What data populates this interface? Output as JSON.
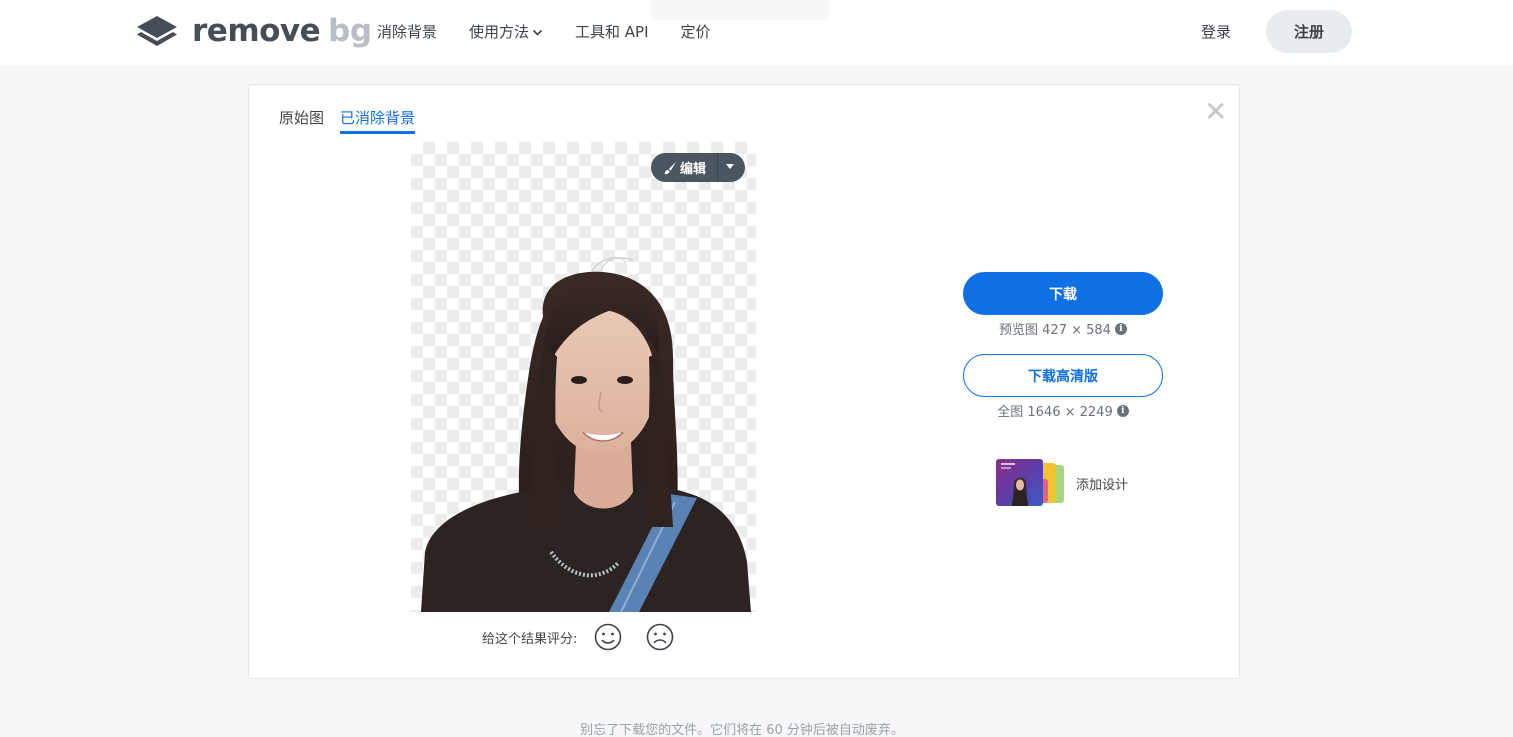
{
  "header": {
    "logo_remove": "remove",
    "logo_bg": "bg",
    "nav": [
      {
        "label": "消除背景"
      },
      {
        "label": "使用方法",
        "has_dropdown": true
      },
      {
        "label": "工具和 API"
      },
      {
        "label": "定价"
      }
    ],
    "login_label": "登录",
    "signup_label": "注册"
  },
  "card": {
    "tabs": [
      {
        "label": "原始图",
        "active": false
      },
      {
        "label": "已消除背景",
        "active": true
      }
    ],
    "close_icon": "close-icon",
    "edit_label": "编辑",
    "rating_label": "给这个结果评分:",
    "download_label": "下载",
    "preview_label": "预览图 427 × 584",
    "download_hd_label": "下载高清版",
    "full_label": "全图 1646 × 2249",
    "add_design_label": "添加设计"
  },
  "footer": {
    "note": "别忘了下载您的文件。它们将在 60 分钟后被自动废弃。"
  },
  "colors": {
    "accent": "#0f70e6",
    "edit_button": "#4b5660",
    "signup_bg": "#e9ecef"
  }
}
